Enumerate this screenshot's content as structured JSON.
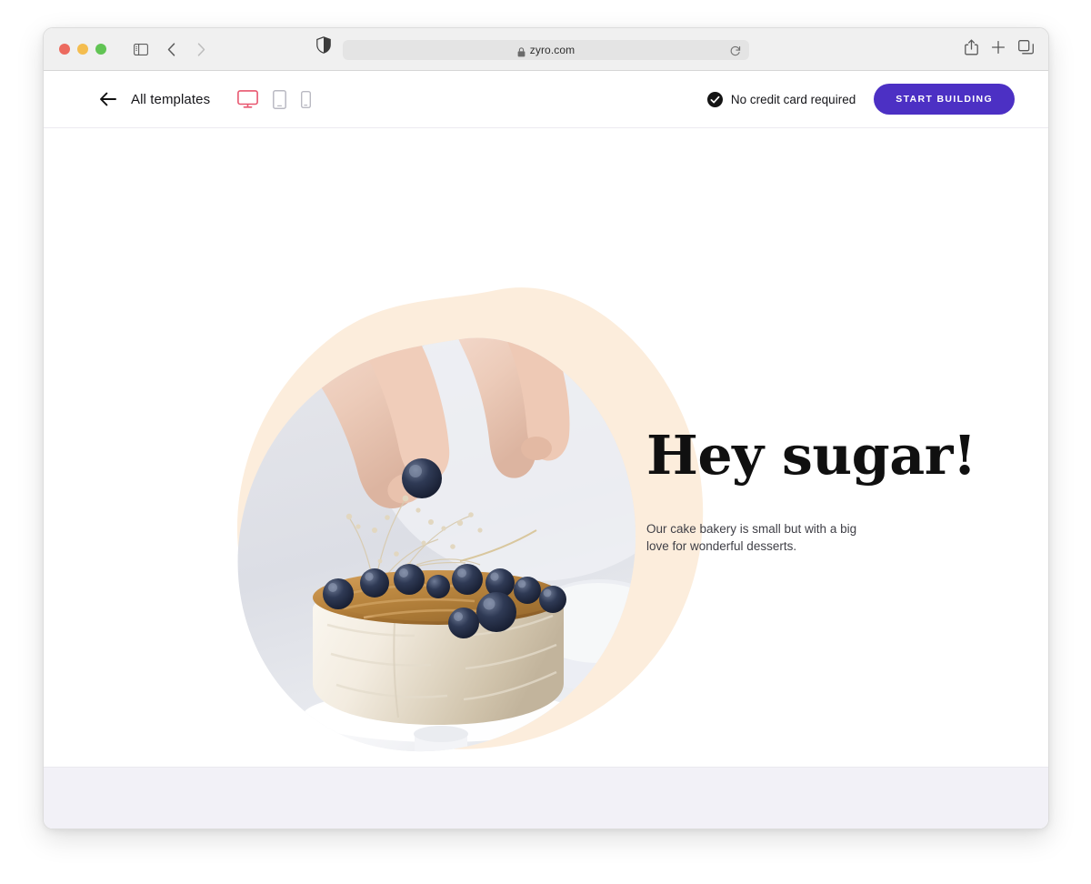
{
  "browser": {
    "traffic_lights": [
      {
        "name": "close",
        "color": "#ec6a5f"
      },
      {
        "name": "minimize",
        "color": "#f4bd4f"
      },
      {
        "name": "maximize",
        "color": "#61c454"
      }
    ],
    "sidebar_toggle": "sidebar-icon",
    "back": "back-chevron-icon",
    "forward": "forward-chevron-icon",
    "shield": "privacy-shield-icon",
    "address": {
      "url": "zyro.com",
      "lock": "lock-icon",
      "reload": "reload-icon"
    },
    "toolbar_right": [
      {
        "name": "share-icon",
        "label": "Share"
      },
      {
        "name": "plus-icon",
        "label": "New Tab"
      },
      {
        "name": "tabs-icon",
        "label": "Show Tab Overview"
      }
    ]
  },
  "header": {
    "back_label": "back-arrow-icon",
    "all_templates": "All templates",
    "devices": [
      {
        "name": "desktop",
        "active": true
      },
      {
        "name": "tablet",
        "active": false
      },
      {
        "name": "mobile",
        "active": false
      }
    ],
    "no_credit_card": "No credit card required",
    "cta_label": "START BUILDING",
    "cta_color": "#4c30c4",
    "active_device_color": "#e8566f"
  },
  "hero": {
    "title": "Hey sugar!",
    "subtitle": "Our cake bakery is small but with a big love for wonderful desserts.",
    "blob_color": "#fceddc",
    "photo_alt": "Hand placing a blueberry on a frosted layer cake topped with blueberries and dried flowers",
    "title_color": "#101010",
    "subtitle_color": "#3f3f46"
  },
  "footer": {
    "background": "#f2f1f7"
  }
}
